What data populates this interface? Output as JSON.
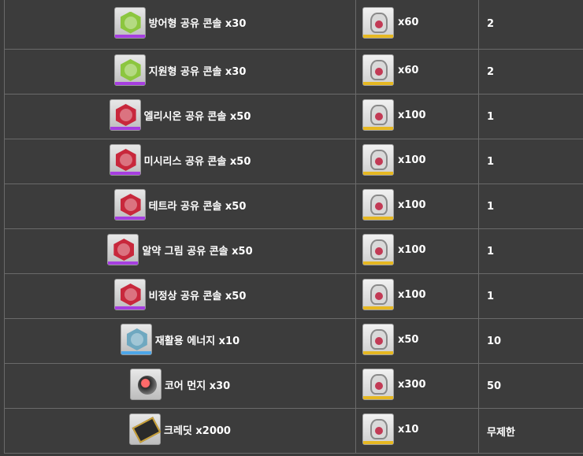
{
  "colors": {
    "purple_rarity": "#a63ee0",
    "blue_rarity": "#4da6e8",
    "gold_rarity": "#e6b822",
    "green_hex": "#8cc63f",
    "red_hex": "#c8283c",
    "teal_hex": "#6fa8c0"
  },
  "rows": [
    {
      "item": "방어형 공유 콘솔 x30",
      "icon": "green-console-icon",
      "cost": "x60",
      "limit": "2"
    },
    {
      "item": "지원형 공유 콘솔 x30",
      "icon": "green-console-icon",
      "cost": "x60",
      "limit": "2"
    },
    {
      "item": "엘리시온 공유 콘솔 x50",
      "icon": "red-console-icon",
      "cost": "x100",
      "limit": "1"
    },
    {
      "item": "미시리스 공유 콘솔 x50",
      "icon": "red-console-icon",
      "cost": "x100",
      "limit": "1"
    },
    {
      "item": "테트라 공유 콘솔 x50",
      "icon": "red-console-icon",
      "cost": "x100",
      "limit": "1"
    },
    {
      "item": "알약 그림 공유 콘솔 x50",
      "icon": "red-console-icon",
      "cost": "x100",
      "limit": "1"
    },
    {
      "item": "비정상 공유 콘솔 x50",
      "icon": "red-console-icon",
      "cost": "x100",
      "limit": "1"
    },
    {
      "item": "재활용 에너지 x10",
      "icon": "energy-icon",
      "cost": "x50",
      "limit": "10"
    },
    {
      "item": "코어 먼지 x30",
      "icon": "core-dust-icon",
      "cost": "x300",
      "limit": "50"
    },
    {
      "item": "크레딧 x2000",
      "icon": "credit-icon",
      "cost": "x10",
      "limit": "무제한"
    }
  ]
}
